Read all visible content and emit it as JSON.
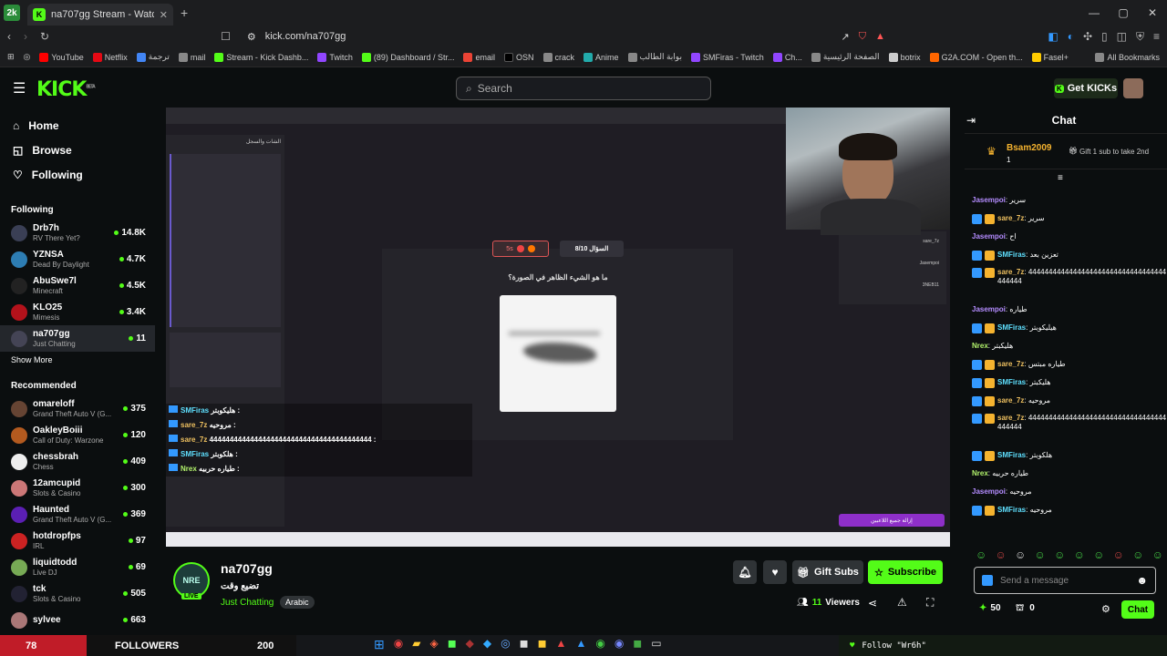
{
  "browser": {
    "tab_title": "na707gg Stream - Watch Live on",
    "url": "kick.com/na707gg"
  },
  "bookmarks": [
    "YouTube",
    "Netflix",
    "ترجمة",
    "mail",
    "Stream - Kick Dashb...",
    "Twitch",
    "(89) Dashboard / Str...",
    "email",
    "OSN",
    "crack",
    "Anime",
    "بوابة الطالب",
    "SMFiras - Twitch",
    "Ch...",
    "الصفحة الرئيسية",
    "botrix",
    "G2A.COM - Open th...",
    "Fasel+",
    "All Bookmarks"
  ],
  "header": {
    "logo": "KICK",
    "beta": "BETA",
    "search_placeholder": "Search",
    "get_kicks": "Get KICKs"
  },
  "nav": {
    "home": "Home",
    "browse": "Browse",
    "following": "Following"
  },
  "following": {
    "title": "Following",
    "channels": [
      {
        "name": "Drb7h",
        "game": "RV There Yet?",
        "viewers": "14.8K",
        "color": "#3a3f55"
      },
      {
        "name": "YZNSA",
        "game": "Dead By Daylight",
        "viewers": "4.7K",
        "color": "#2d7db3"
      },
      {
        "name": "AbuSwe7l",
        "game": "Minecraft",
        "viewers": "4.5K",
        "color": "#222"
      },
      {
        "name": "KLO25",
        "game": "Mimesis",
        "viewers": "3.4K",
        "color": "#b3121b"
      },
      {
        "name": "na707gg",
        "game": "Just Chatting",
        "viewers": "11",
        "color": "#445"
      }
    ],
    "show_more": "Show More"
  },
  "recommended": {
    "title": "Recommended",
    "channels": [
      {
        "name": "omareloff",
        "game": "Grand Theft Auto V (G...",
        "viewers": "375",
        "color": "#664433"
      },
      {
        "name": "OakleyBoiii",
        "game": "Call of Duty: Warzone",
        "viewers": "120",
        "color": "#b35a1f"
      },
      {
        "name": "chessbrah",
        "game": "Chess",
        "viewers": "409",
        "color": "#eee"
      },
      {
        "name": "12amcupid",
        "game": "Slots & Casino",
        "viewers": "300",
        "color": "#c77"
      },
      {
        "name": "Haunted",
        "game": "Grand Theft Auto V (G...",
        "viewers": "369",
        "color": "#5b1fb3"
      },
      {
        "name": "hotdropfps",
        "game": "IRL",
        "viewers": "97",
        "color": "#c22"
      },
      {
        "name": "liquidtodd",
        "game": "Live DJ",
        "viewers": "69",
        "color": "#7a5"
      },
      {
        "name": "tck",
        "game": "Slots & Casino",
        "viewers": "505",
        "color": "#223"
      },
      {
        "name": "sylvee",
        "game": "",
        "viewers": "663",
        "color": "#a77"
      }
    ]
  },
  "video": {
    "question_label": "السؤال 8/10",
    "timer": "5s",
    "question": "ما هو الشيء الظاهر في الصورة؟",
    "overlay_chat": [
      {
        "user": "SMFiras",
        "text": "هليكوبتر :"
      },
      {
        "user": "sare_7z",
        "text": "مروحيه :"
      },
      {
        "user": "sare_7z",
        "text": "4444444444444444444444444444444444444444 :"
      },
      {
        "user": "SMFiras",
        "text": "هلكوبتر :"
      },
      {
        "user": "Nrex",
        "text": "طياره حربيه :"
      }
    ],
    "panel_title": "الشات والسجل",
    "players": [
      "sare_7z",
      "Jasempoi",
      "3NEB11"
    ],
    "bottom_btn": "إزالة جميع اللاعبين"
  },
  "stream": {
    "channel": "na707gg",
    "title": "تضيع وقت",
    "category": "Just Chatting",
    "tag": "Arabic",
    "live": "LIVE",
    "viewers": "11",
    "viewers_label": "Viewers",
    "gift_subs": "Gift Subs",
    "subscribe": "Subscribe"
  },
  "chat": {
    "title": "Chat",
    "pinned_user": "Bsam2009",
    "pinned_count": "1",
    "pinned_text": "Gift 1 sub to take 2nd",
    "messages": [
      {
        "user": "Jasempoi",
        "text": "سرير",
        "color": "#b48cff",
        "badge": false
      },
      {
        "user": "sare_7z",
        "text": "سرير",
        "color": "#eec060",
        "badge": true
      },
      {
        "user": "Jasempoi",
        "text": "اح",
        "color": "#b48cff",
        "badge": false
      },
      {
        "user": "SMFiras",
        "text": "تعزين بعد",
        "color": "#5fe0ff",
        "badge": true
      },
      {
        "user": "sare_7z",
        "text": "4444444444444444444444444444444444444444",
        "color": "#eec060",
        "badge": true
      },
      {
        "user": "Jasempoi",
        "text": "طياره",
        "color": "#b48cff",
        "badge": false
      },
      {
        "user": "SMFiras",
        "text": "هيليكوبتر",
        "color": "#5fe0ff",
        "badge": true
      },
      {
        "user": "Nrex",
        "text": "هليكبتر",
        "color": "#b2f26c",
        "badge": false
      },
      {
        "user": "sare_7z",
        "text": "طياره مبتس",
        "color": "#eec060",
        "badge": true
      },
      {
        "user": "SMFiras",
        "text": "هليكبتر",
        "color": "#5fe0ff",
        "badge": true
      },
      {
        "user": "sare_7z",
        "text": "مروحيه",
        "color": "#eec060",
        "badge": true
      },
      {
        "user": "sare_7z",
        "text": "4444444444444444444444444444444444444444",
        "color": "#eec060",
        "badge": true
      },
      {
        "user": "SMFiras",
        "text": "هلكوبتر",
        "color": "#5fe0ff",
        "badge": true
      },
      {
        "user": "Nrex",
        "text": "طياره حربيه",
        "color": "#b2f26c",
        "badge": false
      },
      {
        "user": "Jasempoi",
        "text": "مروحيه",
        "color": "#b48cff",
        "badge": false
      },
      {
        "user": "SMFiras",
        "text": "مروحيه",
        "color": "#5fe0ff",
        "badge": true
      }
    ],
    "input_placeholder": "Send a message",
    "points": "50",
    "gifts": "0",
    "send": "Chat"
  },
  "taskbar": {
    "followers_count": "78",
    "followers_label": "FOLLOWERS",
    "followers_goal": "200",
    "follow_text": "Follow \"Wr6h\""
  }
}
